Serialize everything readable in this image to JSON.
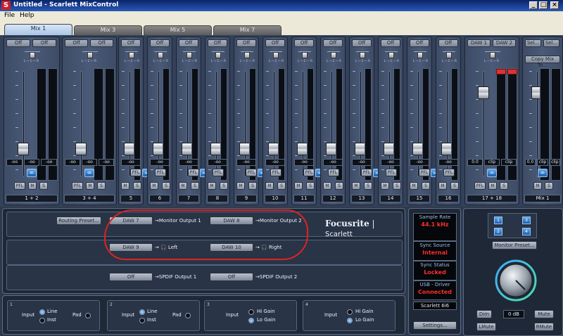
{
  "window": {
    "title": "Untitled - Scarlett MixControl",
    "icon": "S"
  },
  "menu": [
    "File",
    "Help"
  ],
  "tabs": [
    "Mix 1",
    "Mix 3",
    "Mix 5",
    "Mix 7"
  ],
  "strips": [
    {
      "label": "1 + 2",
      "off": [
        "Off",
        "Off"
      ],
      "vals": [
        "-oo",
        "-oo",
        "-oo"
      ],
      "stereo": true
    },
    {
      "label": "3 + 4",
      "off": [
        "Off",
        "Off"
      ],
      "vals": [
        "-oo",
        "-oo",
        "-oo"
      ],
      "stereo": true
    },
    {
      "label": "5",
      "off": [
        "Off"
      ],
      "vals": [
        "-oo"
      ]
    },
    {
      "label": "6",
      "off": [
        "Off"
      ],
      "vals": [
        "-oo"
      ]
    },
    {
      "label": "7",
      "off": [
        "Off"
      ],
      "vals": [
        "-oo"
      ]
    },
    {
      "label": "8",
      "off": [
        "Off"
      ],
      "vals": [
        "-oo"
      ]
    },
    {
      "label": "9",
      "off": [
        "Off"
      ],
      "vals": [
        "-oo"
      ]
    },
    {
      "label": "10",
      "off": [
        "Off"
      ],
      "vals": [
        "-oo"
      ]
    },
    {
      "label": "11",
      "off": [
        "Off"
      ],
      "vals": [
        "-oo"
      ]
    },
    {
      "label": "12",
      "off": [
        "Off"
      ],
      "vals": [
        "-oo"
      ]
    },
    {
      "label": "13",
      "off": [
        "Off"
      ],
      "vals": [
        "-oo"
      ]
    },
    {
      "label": "14",
      "off": [
        "Off"
      ],
      "vals": [
        "-oo"
      ]
    },
    {
      "label": "15",
      "off": [
        "Off"
      ],
      "vals": [
        "-oo"
      ]
    },
    {
      "label": "16",
      "off": [
        "Off"
      ],
      "vals": [
        "-oo"
      ]
    },
    {
      "label": "17 + 18",
      "off": [
        "DAW 1",
        "DAW 2"
      ],
      "vals": [
        "0.0",
        "clip",
        "clip"
      ],
      "stereo": true
    },
    {
      "label": "Mix 1",
      "off": [
        "Sel...",
        "Sel..."
      ],
      "vals": [
        "0.0",
        "clip",
        "clip"
      ],
      "stereo": true
    }
  ],
  "strip_buttons": {
    "pfl": "PFL",
    "mute": "M",
    "solo": "S",
    "link": "∞",
    "copy_mix": "Copy Mix To..."
  },
  "routing": {
    "preset_button": "Routing Preset...",
    "brand": "Focusrite",
    "brand_sub": "Scarlett",
    "rows": [
      [
        {
          "source": "DAW 7",
          "dest": "Monitor Output 1"
        },
        {
          "source": "DAW 8",
          "dest": "Monitor Output 2"
        }
      ],
      [
        {
          "source": "DAW 9",
          "dest": "Left"
        },
        {
          "source": "DAW 10",
          "dest": "Right"
        }
      ],
      [
        {
          "source": "Off",
          "dest": "SPDIF Output 1"
        },
        {
          "source": "Off",
          "dest": "SPDIF Output 2"
        }
      ]
    ]
  },
  "status": {
    "sample_rate_label": "Sample Rate",
    "sample_rate": "44.1 kHz",
    "sync_source_label": "Sync Source",
    "sync_source": "Internal",
    "sync_status_label": "Sync Status",
    "sync_status": "Locked",
    "usb_label": "USB - Driver",
    "usb_status": "Connected",
    "device": "Scarlett 6i6",
    "settings_button": "Settings..."
  },
  "monitor": {
    "numbers": [
      "1",
      "2",
      "3",
      "4"
    ],
    "preset_button": "Monitor Preset...",
    "dim": "Dim",
    "level": "0 dB",
    "mute": "Mute",
    "lmute": "LMute",
    "rmute": "RMute"
  },
  "inputs": [
    {
      "num": "1",
      "input": "Input",
      "opt1": "Line",
      "opt2": "Inst",
      "pad": "Pad"
    },
    {
      "num": "2",
      "input": "Input",
      "opt1": "Line",
      "opt2": "Inst",
      "pad": "Pad"
    },
    {
      "num": "3",
      "input": "Input",
      "opt1": "Hi Gain",
      "opt2": "Lo Gain"
    },
    {
      "num": "4",
      "input": "Input",
      "opt1": "Hi Gain",
      "opt2": "Lo Gain"
    }
  ]
}
